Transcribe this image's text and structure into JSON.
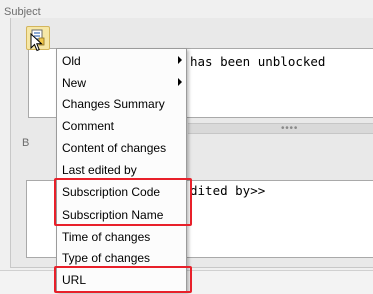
{
  "subject": {
    "label": "Subject",
    "value": "has been unblocked"
  },
  "body": {
    "label": "B",
    "value": "dited by>>"
  },
  "menu": {
    "items": [
      {
        "label": "Old",
        "submenu": true
      },
      {
        "label": "New",
        "submenu": true
      },
      {
        "label": "Changes Summary",
        "submenu": false
      },
      {
        "label": "Comment",
        "submenu": false
      },
      {
        "label": "Content of changes",
        "submenu": false
      },
      {
        "label": "Last edited by",
        "submenu": false
      },
      {
        "label": "Subscription Code",
        "submenu": false
      },
      {
        "label": "Subscription Name",
        "submenu": false
      },
      {
        "label": "Time of changes",
        "submenu": false
      },
      {
        "label": "Type of changes",
        "submenu": false
      },
      {
        "label": "URL",
        "submenu": false
      }
    ]
  },
  "highlight_color": "#e8202a",
  "icons": {
    "insert_field": "insert-field-icon",
    "cursor": "mouse-pointer-icon",
    "splitter": "splitter-grip-icon"
  }
}
